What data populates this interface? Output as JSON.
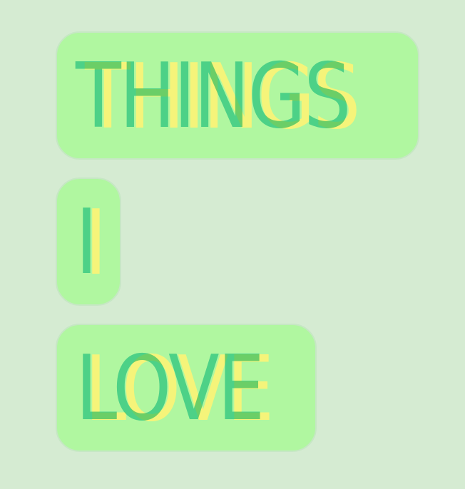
{
  "pills": [
    {
      "text": "THINGS"
    },
    {
      "text": "I"
    },
    {
      "text": "LOVE"
    }
  ],
  "colors": {
    "background": "#d5ebd2",
    "pill_fill": "#b0f7a0",
    "pill_border": "#c6e7c4",
    "text_front": "#6fd8d7",
    "text_back": "#f5f47a"
  }
}
